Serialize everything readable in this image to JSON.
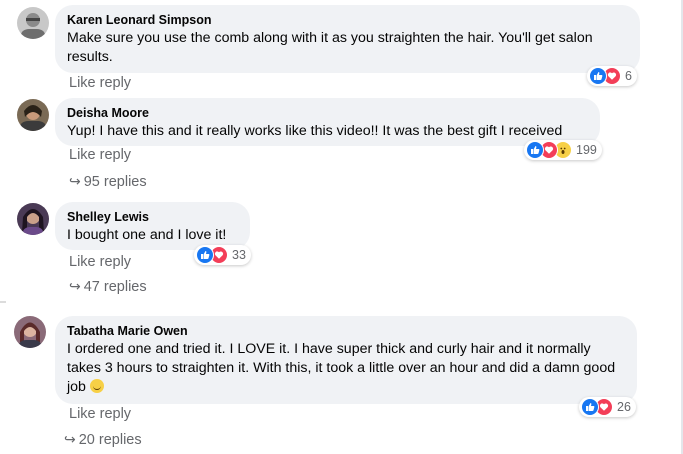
{
  "colors": {
    "bubble": "#f0f2f5",
    "like": "#1877f2",
    "love": "#f33e58",
    "wow": "#f7d046",
    "meta": "#65676b"
  },
  "comments": [
    {
      "author": "Karen Leonard Simpson",
      "text": "Make sure you use the comb along with it as you straighten the hair. You'll get salon results.",
      "action_label": "Like reply",
      "reaction_icons": [
        "like-icon",
        "love-icon"
      ],
      "reaction_count": "6"
    },
    {
      "author": "Deisha Moore",
      "text": "Yup! I have this and it really works like this video!! It was the best gift I received",
      "action_label": "Like reply",
      "reaction_icons": [
        "like-icon",
        "love-icon",
        "wow-icon"
      ],
      "reaction_count": "199",
      "replies_label": "95 replies"
    },
    {
      "author": "Shelley Lewis",
      "text": "I bought one and I love it!",
      "action_label": "Like reply",
      "reaction_icons": [
        "like-icon",
        "love-icon"
      ],
      "reaction_count": "33",
      "replies_label": "47 replies"
    },
    {
      "author": "Tabatha Marie Owen",
      "text": "I ordered one and tried it. I LOVE it. I have super thick and curly hair and it normally takes 3 hours to straighten it. With this, it took a little over an hour and did a damn good job",
      "emoji": "smile-emoji-icon",
      "action_label": "Like reply",
      "reaction_icons": [
        "like-icon",
        "love-icon"
      ],
      "reaction_count": "26",
      "replies_label": "20 replies"
    }
  ]
}
